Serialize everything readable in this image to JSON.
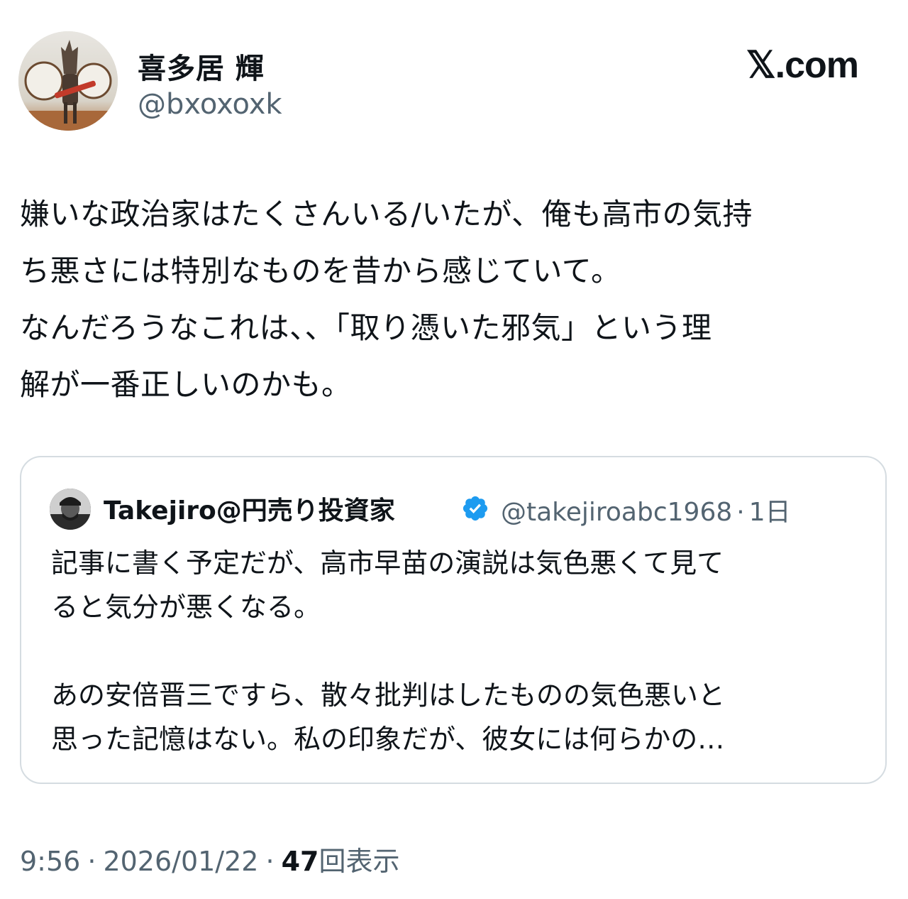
{
  "author": {
    "name": "喜多居 輝",
    "handle": "@bxoxoxk"
  },
  "brand": "𝕏.com",
  "tweet": {
    "text_lines": [
      "嫌いな政治家はたくさんいる/いたが、俺も高市の気持",
      "ち悪さには特別なものを昔から感じていて。",
      "なんだろうなこれは、、「取り憑いた邪気」という理",
      "解が一番正しいのかも。"
    ]
  },
  "quoted_tweet": {
    "name": "Takejiro@円売り投資家",
    "handle": "@takejiroabc1968",
    "separator": "·",
    "time_ago": "1日",
    "verified_icon": "verified-badge-icon",
    "verified_color": "#1d9bf0",
    "text_lines": [
      "記事に書く予定だが、高市早苗の演説は気色悪くて見て",
      "ると気分が悪くなる。",
      "",
      "あの安倍晋三ですら、散々批判はしたものの気色悪いと",
      "思った記憶はない。私の印象だが、彼女には何らかの…"
    ]
  },
  "footer": {
    "time": "9:56",
    "separator": "·",
    "date": "2026/01/22",
    "views_count": "47",
    "views_label": "回表示"
  },
  "colors": {
    "text_primary": "#0f1419",
    "text_secondary": "#536471",
    "border": "#d5dce1",
    "accent": "#1d9bf0"
  }
}
